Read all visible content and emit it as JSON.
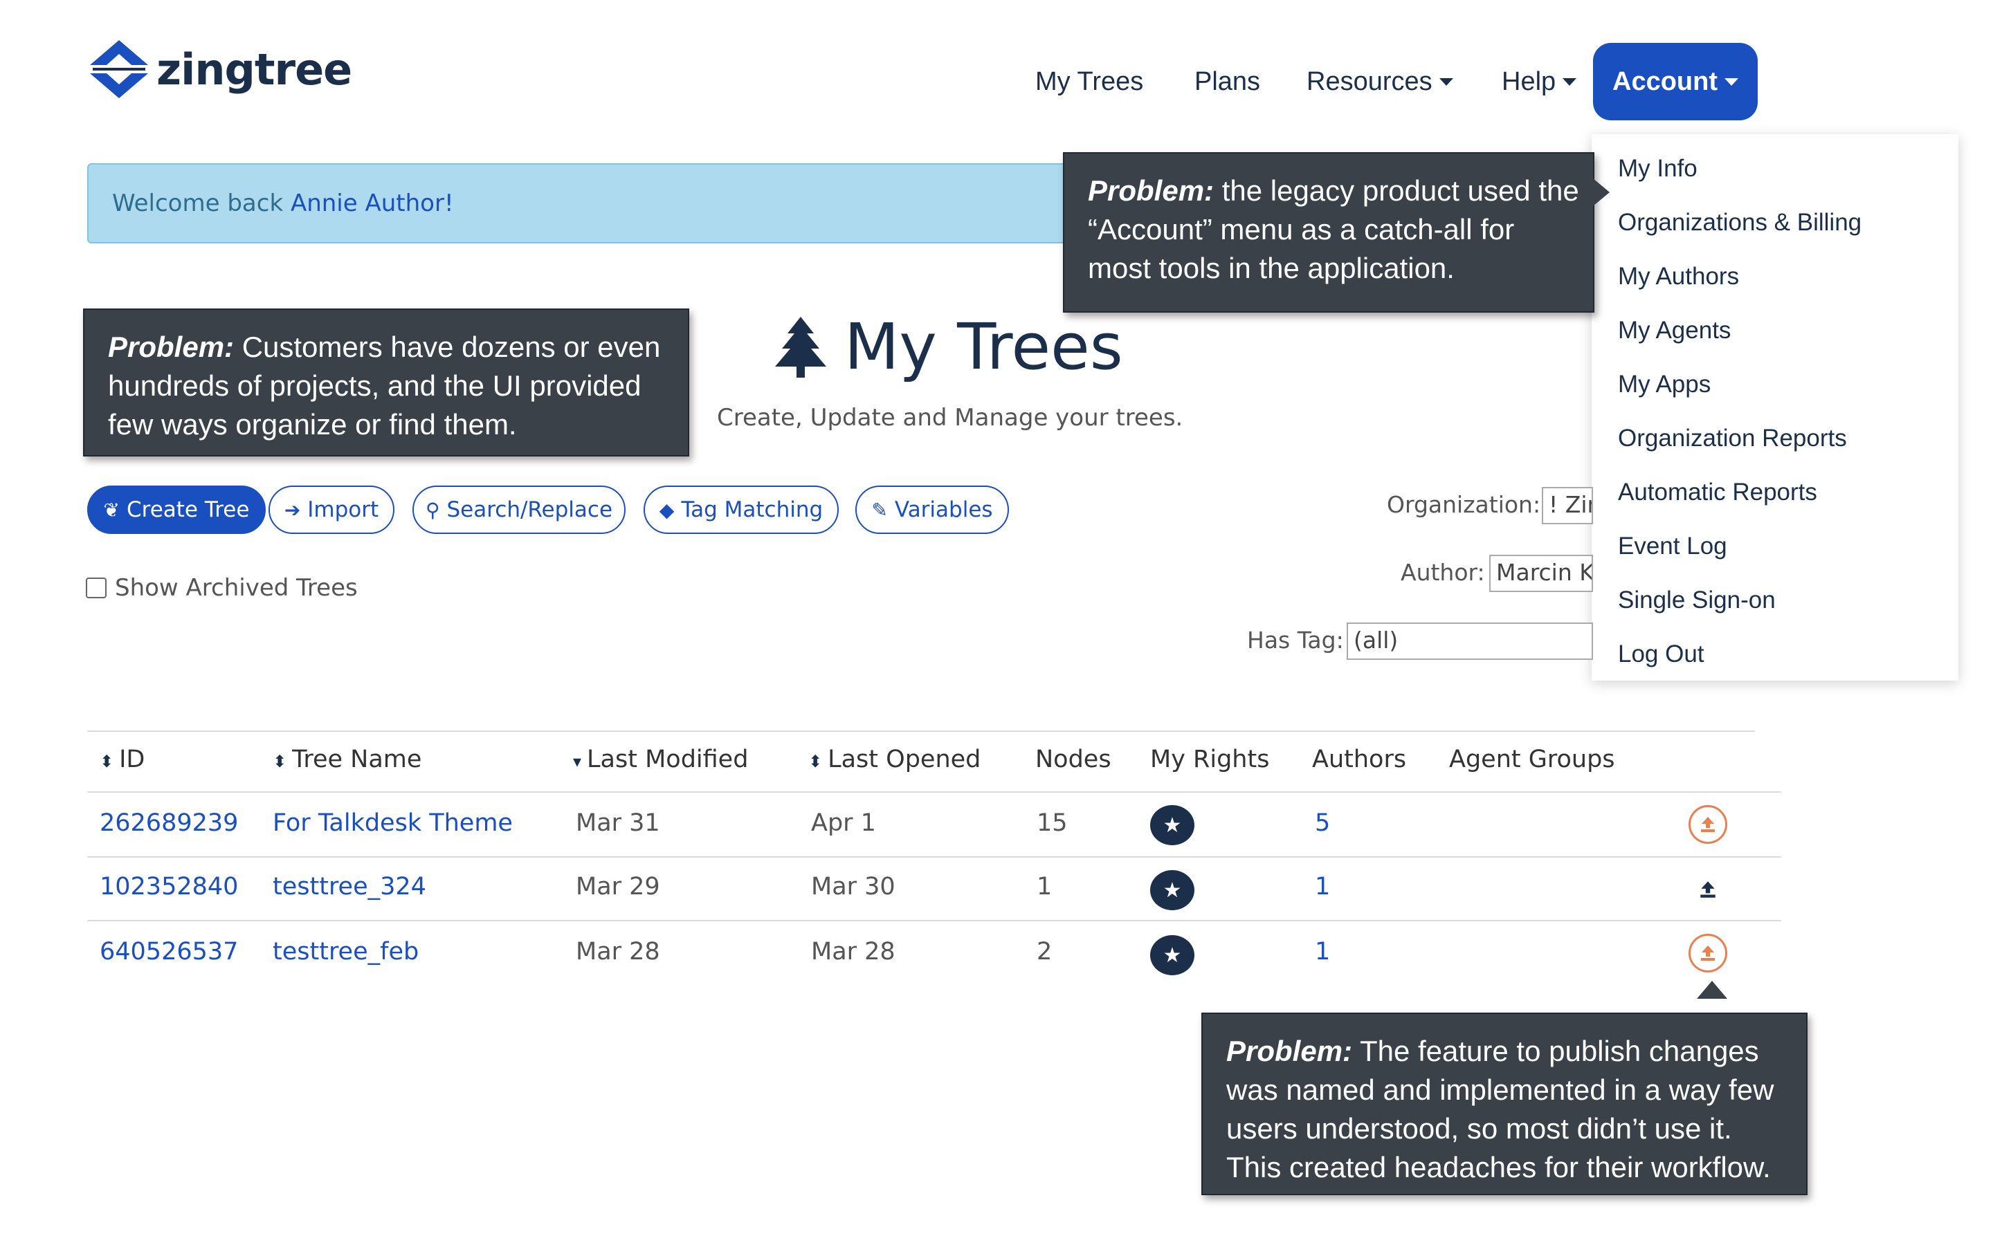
{
  "brand": {
    "name": "zingtree"
  },
  "nav": {
    "items": [
      {
        "label": "My Trees"
      },
      {
        "label": "Plans"
      },
      {
        "label": "Resources",
        "has_caret": true
      },
      {
        "label": "Help",
        "has_caret": true
      }
    ],
    "account_label": "Account"
  },
  "account_menu": {
    "items": [
      "My Info",
      "Organizations & Billing",
      "My Authors",
      "My Agents",
      "My Apps",
      "Organization Reports",
      "Automatic Reports",
      "Event Log",
      "Single Sign-on",
      "Log Out"
    ]
  },
  "welcome": {
    "prefix": "Welcome back ",
    "user": "Annie Author!"
  },
  "page": {
    "title": "My Trees",
    "icon": "tree-icon",
    "subtitle": "Create, Update and Manage your trees."
  },
  "actions": [
    {
      "label": "Create Tree",
      "icon": "leaf-icon"
    },
    {
      "label": "Import",
      "icon": "sign-in-icon"
    },
    {
      "label": "Search/Replace",
      "icon": "search-icon"
    },
    {
      "label": "Tag Matching",
      "icon": "tags-icon"
    },
    {
      "label": "Variables",
      "icon": "edit-icon"
    }
  ],
  "show_archived": {
    "label": "Show Archived Trees",
    "checked": false
  },
  "filters": {
    "organization": {
      "label": "Organization:",
      "value": "! Zin"
    },
    "author": {
      "label": "Author:",
      "value": "Marcin K"
    },
    "has_tag": {
      "label": "Has Tag:",
      "value": "(all)"
    }
  },
  "table": {
    "columns": [
      "ID",
      "Tree Name",
      "Last Modified",
      "Last Opened",
      "Nodes",
      "My Rights",
      "Authors",
      "Agent Groups"
    ],
    "rows": [
      {
        "id": "262689239",
        "name": "For Talkdesk Theme",
        "modified": "Mar 31",
        "opened": "Apr 1",
        "nodes": "15",
        "authors": "5",
        "publish_style": "circle"
      },
      {
        "id": "102352840",
        "name": "testtree_324",
        "modified": "Mar 29",
        "opened": "Mar 30",
        "nodes": "1",
        "authors": "1",
        "publish_style": "plain"
      },
      {
        "id": "640526537",
        "name": "testtree_feb",
        "modified": "Mar 28",
        "opened": "Mar 28",
        "nodes": "2",
        "authors": "1",
        "publish_style": "circle"
      }
    ]
  },
  "callouts": {
    "account": {
      "lead": "Problem:",
      "text": " the legacy product used the “Account” menu as a catch-all for most tools in the application."
    },
    "projects": {
      "lead": "Problem:",
      "text": " Customers have dozens or even hundreds of projects, and the UI provided few ways organize or find them."
    },
    "publish": {
      "lead": "Problem:",
      "text": " The feature to publish changes was named and implemented in a way few users understood, so most didn’t use it. This created headaches for their workflow."
    }
  },
  "colors": {
    "brand_blue": "#1a4fbf",
    "navy": "#1c2f4a",
    "welcome_bg": "#aedaf0",
    "callout_bg": "#3a4148",
    "publish_orange": "#e8804f"
  }
}
